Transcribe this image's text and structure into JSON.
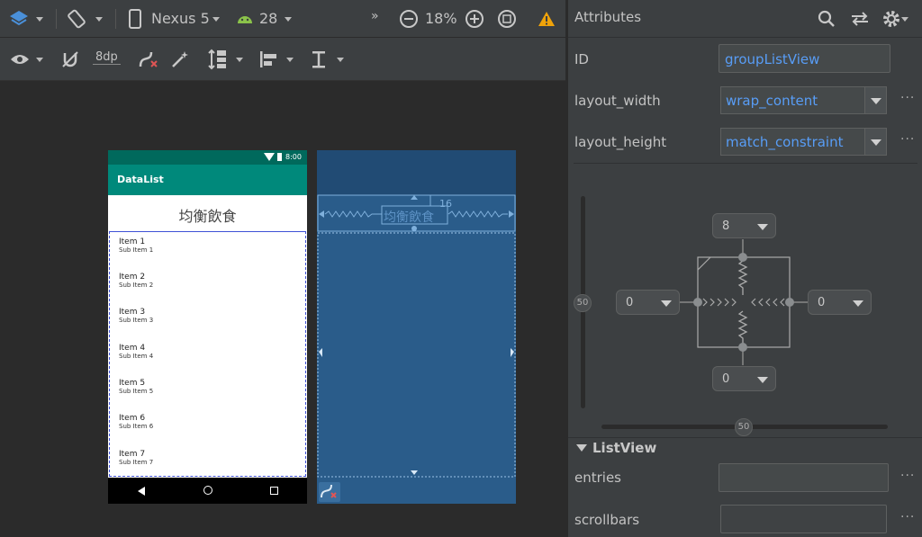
{
  "toolbar": {
    "device": "Nexus 5",
    "api": "28",
    "zoom": "18%",
    "margin": "8dp"
  },
  "phone": {
    "status_time": "8:00",
    "app_title": "DataList",
    "heading": "均衡飲食",
    "items": [
      {
        "title": "Item 1",
        "sub": "Sub Item 1"
      },
      {
        "title": "Item 2",
        "sub": "Sub Item 2"
      },
      {
        "title": "Item 3",
        "sub": "Sub Item 3"
      },
      {
        "title": "Item 4",
        "sub": "Sub Item 4"
      },
      {
        "title": "Item 5",
        "sub": "Sub Item 5"
      },
      {
        "title": "Item 6",
        "sub": "Sub Item 6"
      },
      {
        "title": "Item 7",
        "sub": "Sub Item 7"
      }
    ]
  },
  "blueprint": {
    "heading": "均衡飲食",
    "margin_label": "16"
  },
  "attributes": {
    "title": "Attributes",
    "id_label": "ID",
    "id_value": "groupListView",
    "layout_width_label": "layout_width",
    "layout_width_value": "wrap_content",
    "layout_height_label": "layout_height",
    "layout_height_value": "match_constraint",
    "constraint": {
      "top": "8",
      "left": "0",
      "right": "0",
      "bottom": "0",
      "vertical_bias": "50",
      "horizontal_bias": "50"
    },
    "section": "ListView",
    "entries_label": "entries",
    "scrollbars_label": "scrollbars"
  }
}
